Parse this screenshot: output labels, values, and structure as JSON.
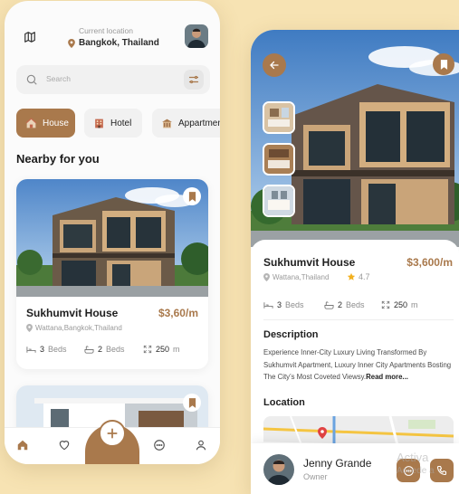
{
  "colors": {
    "background": "#f7e3b3",
    "accent": "#a9794c",
    "star": "#f2b01e",
    "pin": "#e04343"
  },
  "home": {
    "location_label": "Current location",
    "location_value": "Bangkok, Thailand",
    "search_placeholder": "Search",
    "categories": [
      {
        "label": "House",
        "icon": "house-icon",
        "active": true
      },
      {
        "label": "Hotel",
        "icon": "hotel-icon",
        "active": false
      },
      {
        "label": "Appartment",
        "icon": "apartment-icon",
        "active": false
      }
    ],
    "section_title": "Nearby for you",
    "listing": {
      "title": "Sukhumvit House",
      "price": "$3,60/m",
      "address": "Wattana,Bangkok,Thailand",
      "beds_count": "3",
      "beds_label": "Beds",
      "baths_count": "2",
      "baths_label": "Beds",
      "area_value": "250",
      "area_unit": "m"
    },
    "nav": [
      "home-icon",
      "heart-icon",
      "add-icon",
      "chat-icon",
      "profile-icon"
    ]
  },
  "detail": {
    "title": "Sukhumvit House",
    "price": "$3,600/m",
    "address": "Wattana,Thailand",
    "rating": "4.7",
    "beds_count": "3",
    "beds_label": "Beds",
    "baths_count": "2",
    "baths_label": "Beds",
    "area_value": "250",
    "area_unit": "m",
    "description_title": "Description",
    "description_text": "Experience Inner-City Luxury Living Transformed By Sukhumvit Apartment, Luxury Inner City Apartments Bosting The City’s Most Coveted Viewsy.",
    "read_more": "Read more...",
    "location_title": "Location",
    "owner_name": "Jenny Grande",
    "owner_role": "Owner"
  },
  "watermark": {
    "line1": "Activa",
    "line2": "Accede a"
  }
}
